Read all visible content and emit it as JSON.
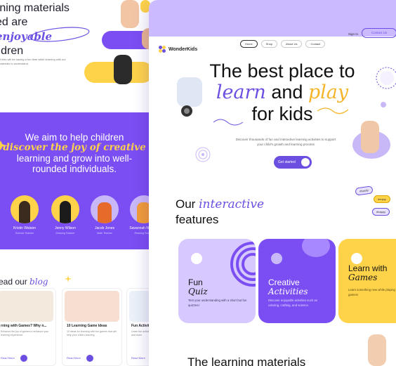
{
  "back": {
    "hero": {
      "title_line1": "rning materials",
      "title_pre": "ed are ",
      "title_highlight": "enjoyable",
      "title_line3": "ildren",
      "subtitle": "st kids will be having a fun time while learning with our materials to understand."
    },
    "mission": {
      "line1": "We aim to help children",
      "highlight": "discover the joy of creative",
      "line3": "learning and grow into well-",
      "line4": "rounded individuals."
    },
    "teachers": [
      {
        "name": "Kristin Watson",
        "role": "Science Teacher"
      },
      {
        "name": "Jenny Wilson",
        "role": "Drawing Teacher"
      },
      {
        "name": "Jacob Jones",
        "role": "Math Teacher"
      },
      {
        "name": "Savannah Nguyen",
        "role": "Reading Teacher"
      }
    ],
    "blog": {
      "title_pre": "ead our ",
      "title_highlight": "blog",
      "cards": [
        {
          "title": "rning with Games? Why n...",
          "desc": "Enhance the joy of games to enhance your learning experience",
          "cta": "Read More"
        },
        {
          "title": "10 Learning Game Ideas",
          "desc": "10 ideas for learning with fun games that will help your child's learning",
          "cta": "Read More"
        },
        {
          "title": "Fun Activities for Kid",
          "desc": "Learn fun activities to help your child grow and learn",
          "cta": "Read More"
        }
      ]
    }
  },
  "front": {
    "brand": "WonderKids",
    "menu": [
      "Home",
      "Shop",
      "About Us",
      "Contact"
    ],
    "signin": "Sign In",
    "contact": "Contact Us",
    "hero": {
      "line1": "The best place to",
      "learn": "learn",
      "and": " and ",
      "play": "play",
      "line3": "for kids",
      "subtitle": "Discover thousands of fun and interactive learning activities to support your child's growth and learning process",
      "cta": "Get started"
    },
    "tags": [
      "#family",
      "#enjoy",
      "#happy"
    ],
    "features": {
      "title_pre": "Our ",
      "title_highlight": "interactive",
      "title_line2": "features",
      "cards": [
        {
          "title": "Fun",
          "title_it": "Quiz",
          "desc": "Test your understanding with a short but fun quizzes!"
        },
        {
          "title": "Creative",
          "title_it": "Activities",
          "desc": "Discover enjoyable activities such as coloring, crafting, and science."
        },
        {
          "title": "Learn with",
          "title_it": "Games",
          "desc": "Learn something new while playing games!"
        }
      ]
    },
    "next_section": "The learning materials"
  },
  "colors": {
    "purple": "#6c4fe0",
    "violet_bg": "#7b4ef3",
    "yellow": "#fed34a",
    "lavender": "#cbbaff"
  }
}
